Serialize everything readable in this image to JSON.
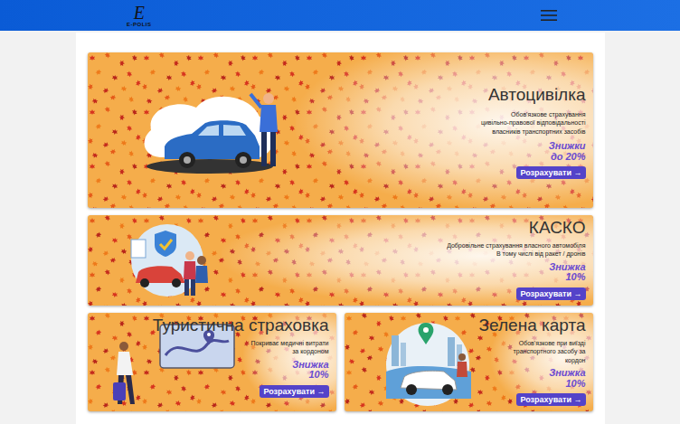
{
  "header": {
    "logo_letter": "E",
    "logo_text": "E-POLIS"
  },
  "cards": [
    {
      "kind": "car-person",
      "title": "Автоцивілка",
      "description": [
        "Обов'язкове страхування",
        "цивільно-правової відповідальності",
        "власників транспортних засобів"
      ],
      "discount": [
        "Знижки",
        "до 20%"
      ],
      "button": "Розрахувати →"
    },
    {
      "kind": "kasko",
      "title": "КАСКО",
      "description": [
        "Добровільне страхування власного автомобіля",
        "В тому числі від ракет / дронів"
      ],
      "discount": [
        "Знижка",
        "10%"
      ],
      "button": "Розрахувати →"
    },
    {
      "kind": "travel",
      "title": "Туристична страховка",
      "description": [
        "Покриває медичні витрати за кордоном"
      ],
      "discount": [
        "Знижка",
        "10%"
      ],
      "button": "Розрахувати →"
    },
    {
      "kind": "green-card",
      "title": "Зелена карта",
      "description": [
        "Обов'язкове при виїзді транспортного засобу за кордон"
      ],
      "discount": [
        "Знижка",
        "10%"
      ],
      "button": "Розрахувати →"
    }
  ]
}
